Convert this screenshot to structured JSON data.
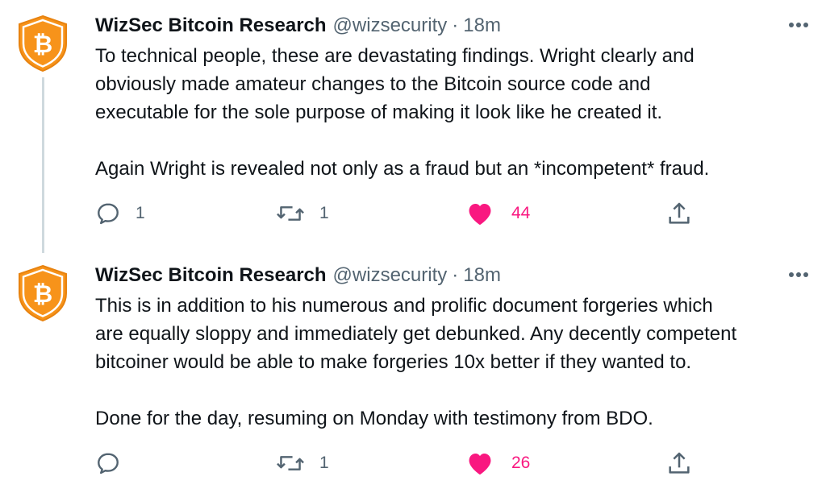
{
  "tweets": [
    {
      "display_name": "WizSec Bitcoin Research",
      "handle": "@wizsecurity",
      "separator": "·",
      "time": "18m",
      "text": "To technical people, these are devastating findings. Wright clearly and\nobviously made amateur changes to the Bitcoin source code and\nexecutable for the sole purpose of making it look like he created it.\n\nAgain Wright is revealed not only as a fraud but an *incompetent* fraud.",
      "reply_count": "1",
      "retweet_count": "1",
      "like_count": "44",
      "liked": true
    },
    {
      "display_name": "WizSec Bitcoin Research",
      "handle": "@wizsecurity",
      "separator": "·",
      "time": "18m",
      "text": "This is in addition to his numerous and prolific document forgeries which\nare equally sloppy and immediately get debunked. Any decently competent\nbitcoiner would be able to make forgeries 10x better if they wanted to.\n\nDone for the day, resuming on Monday with testimony from BDO.",
      "reply_count": "",
      "retweet_count": "1",
      "like_count": "26",
      "liked": true
    }
  ],
  "avatar_symbol": "₿",
  "colors": {
    "accent_like": "#f91880",
    "avatar_orange": "#f7931a",
    "muted": "#536471",
    "thread_line": "#cfd9de"
  },
  "icons": [
    "bitcoin-shield-icon",
    "more-icon",
    "reply-icon",
    "retweet-icon",
    "heart-icon",
    "share-icon"
  ]
}
